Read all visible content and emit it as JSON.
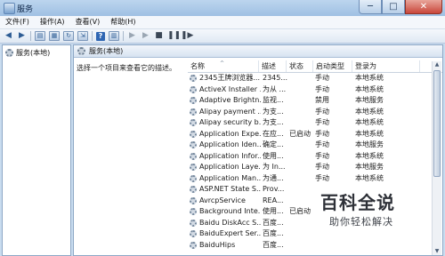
{
  "window": {
    "title": "服务",
    "buttons": [
      "─",
      "□",
      "✕"
    ]
  },
  "menu": [
    "文件(F)",
    "操作(A)",
    "查看(V)",
    "帮助(H)"
  ],
  "toolbar": {
    "icons": [
      "back-arrow",
      "forward-arrow",
      "console-tree",
      "properties",
      "refresh",
      "export",
      "help",
      "start",
      "stop",
      "pause",
      "restart"
    ]
  },
  "tree": {
    "item": "服务(本地)"
  },
  "main": {
    "title": "服务(本地)",
    "description": "选择一个项目来查看它的描述。",
    "columns": {
      "name": "名称",
      "desc": "描述",
      "status": "状态",
      "startup": "启动类型",
      "logon": "登录为"
    },
    "rows": [
      {
        "name": "2345王牌浏览器...",
        "desc": "2345...",
        "status": "",
        "startup": "手动",
        "logon": "本地系统"
      },
      {
        "name": "ActiveX Installer ...",
        "desc": "为从 ...",
        "status": "",
        "startup": "手动",
        "logon": "本地系统"
      },
      {
        "name": "Adaptive Brightn...",
        "desc": "监视...",
        "status": "",
        "startup": "禁用",
        "logon": "本地服务"
      },
      {
        "name": "Alipay payment ...",
        "desc": "为支...",
        "status": "",
        "startup": "手动",
        "logon": "本地系统"
      },
      {
        "name": "Alipay security b...",
        "desc": "为支...",
        "status": "",
        "startup": "手动",
        "logon": "本地系统"
      },
      {
        "name": "Application Expe...",
        "desc": "在应...",
        "status": "已启动",
        "startup": "手动",
        "logon": "本地系统"
      },
      {
        "name": "Application Iden...",
        "desc": "确定...",
        "status": "",
        "startup": "手动",
        "logon": "本地服务"
      },
      {
        "name": "Application Infor...",
        "desc": "使用...",
        "status": "",
        "startup": "手动",
        "logon": "本地系统"
      },
      {
        "name": "Application Laye...",
        "desc": "为 In...",
        "status": "",
        "startup": "手动",
        "logon": "本地服务"
      },
      {
        "name": "Application Man...",
        "desc": "为通...",
        "status": "",
        "startup": "手动",
        "logon": "本地系统"
      },
      {
        "name": "ASP.NET State S...",
        "desc": "Prov...",
        "status": "",
        "startup": "",
        "logon": ""
      },
      {
        "name": "AvrcpService",
        "desc": "REA...",
        "status": "",
        "startup": "",
        "logon": ""
      },
      {
        "name": "Background Inte...",
        "desc": "使用...",
        "status": "已启动",
        "startup": "",
        "logon": ""
      },
      {
        "name": "Baidu DiskAcc S...",
        "desc": "百度...",
        "status": "",
        "startup": "",
        "logon": ""
      },
      {
        "name": "BaiduExpert Ser...",
        "desc": "百度...",
        "status": "",
        "startup": "",
        "logon": ""
      },
      {
        "name": "BaiduHips",
        "desc": "百度...",
        "status": "",
        "startup": "",
        "logon": ""
      }
    ]
  },
  "watermark": {
    "brand": "百科全说",
    "tagline": "助你轻松解决"
  },
  "colors": {
    "titlebar": "#9fc0e3",
    "close": "#c9463a",
    "pane_border": "#8ea8c6"
  }
}
